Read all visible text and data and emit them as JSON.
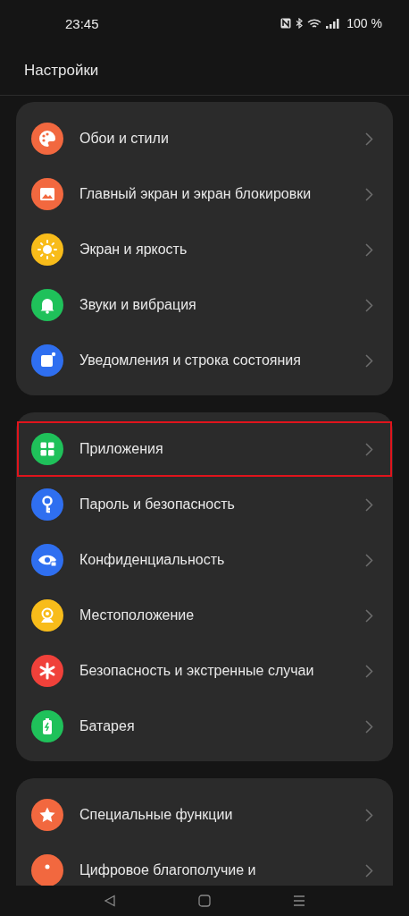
{
  "status_bar": {
    "time": "23:45",
    "battery": "100 %"
  },
  "header": {
    "title": "Настройки"
  },
  "groups": [
    {
      "items": [
        {
          "label": "Обои и стили",
          "kind": "palette",
          "color": "#f2683f",
          "highlighted": false
        },
        {
          "label": "Главный экран и экран блокировки",
          "kind": "image",
          "color": "#f2683f",
          "highlighted": false
        },
        {
          "label": "Экран и яркость",
          "kind": "sun",
          "color": "#f8bc1a",
          "highlighted": false
        },
        {
          "label": "Звуки и вибрация",
          "kind": "bell",
          "color": "#1fc15a",
          "highlighted": false
        },
        {
          "label": "Уведомления и строка состояния",
          "kind": "notice",
          "color": "#2f6ff0",
          "highlighted": false
        }
      ]
    },
    {
      "items": [
        {
          "label": "Приложения",
          "kind": "apps",
          "color": "#1fc15a",
          "highlighted": true
        },
        {
          "label": "Пароль и безопасность",
          "kind": "key",
          "color": "#2f6ff0",
          "highlighted": false
        },
        {
          "label": "Конфиденциальность",
          "kind": "eye",
          "color": "#2f6ff0",
          "highlighted": false
        },
        {
          "label": "Местоположение",
          "kind": "pin",
          "color": "#f8bc1a",
          "highlighted": false
        },
        {
          "label": "Безопасность и экстренные случаи",
          "kind": "asterisk",
          "color": "#f0413a",
          "highlighted": false
        },
        {
          "label": "Батарея",
          "kind": "battery",
          "color": "#1fc15a",
          "highlighted": false
        }
      ]
    },
    {
      "items": [
        {
          "label": "Специальные функции",
          "kind": "star",
          "color": "#f2683f",
          "highlighted": false
        },
        {
          "label": "Цифровое благополучие и",
          "kind": "dot",
          "color": "#f2683f",
          "highlighted": false
        }
      ]
    }
  ]
}
